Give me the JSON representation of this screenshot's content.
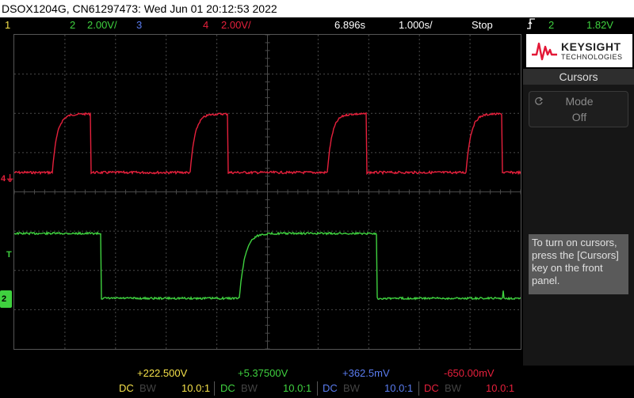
{
  "title_bar": "DSOX1204G, CN61297473: Wed Jun 01 20:12:53 2022",
  "status": {
    "ch1_num": "1",
    "ch2_num": "2",
    "ch2_scale": "2.00V/",
    "ch3_num": "3",
    "ch4_num": "4",
    "ch4_scale": "2.00V/",
    "time_delay": "6.896s",
    "time_scale": "1.000s/",
    "run_state": "Stop",
    "trig_source": "2",
    "trig_level": "1.82V"
  },
  "markers": {
    "ch4_ground": "4",
    "trigger_level": "T",
    "ch2_ground": "2"
  },
  "side_panel": {
    "brand": "KEYSIGHT",
    "brand_sub": "TECHNOLOGIES",
    "menu_title": "Cursors",
    "mode_label": "Mode",
    "mode_value": "Off",
    "help_text": "To turn on cursors, press the [Cursors] key on the front panel."
  },
  "bottom": {
    "offsets": [
      "+222.500V",
      "+5.37500V",
      "+362.5mV",
      "-650.00mV"
    ],
    "channels": [
      {
        "coupling": "DC",
        "bw": "BW",
        "probe": "10.0:1"
      },
      {
        "coupling": "DC",
        "bw": "BW",
        "probe": "10.0:1"
      },
      {
        "coupling": "DC",
        "bw": "BW",
        "probe": "10.0:1"
      },
      {
        "coupling": "DC",
        "bw": "BW",
        "probe": "10.0:1"
      }
    ]
  },
  "colors": {
    "ch1": "#f5e14a",
    "ch2": "#3fd13f",
    "ch3": "#5a7cf0",
    "ch4": "#e6203c",
    "trigger_marker": "#f0a030",
    "grid": "#4a4a4a"
  }
}
